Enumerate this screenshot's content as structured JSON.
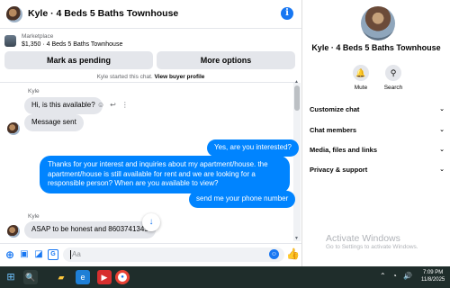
{
  "header": {
    "title": "Kyle · 4 Beds 5 Baths Townhouse"
  },
  "marketplace": {
    "label": "Marketplace",
    "item": "$1,350 · 4 Beds 5 Baths Townhouse"
  },
  "actions": {
    "mark_pending": "Mark as pending",
    "more_options": "More options"
  },
  "chat_start": {
    "prefix": "Kyle started this chat.",
    "link": "View buyer profile"
  },
  "messages": [
    {
      "sender": "Kyle",
      "text": "Hi, is this available?",
      "direction": "in"
    },
    {
      "sender": "",
      "text": "Message sent",
      "direction": "in"
    },
    {
      "sender": "",
      "text": "Yes, are you interested?",
      "direction": "out"
    },
    {
      "sender": "",
      "text": "Thanks for your interest and inquiries about my apartment/house. the apartment/house is still available for rent and we are looking for a responsible person? When are you available to view?",
      "direction": "out"
    },
    {
      "sender": "",
      "text": "send me your phone number",
      "direction": "out"
    },
    {
      "sender": "Kyle",
      "text": "ASAP to be honest and 8603741349",
      "direction": "in"
    }
  ],
  "composer": {
    "placeholder": "Aa"
  },
  "right_panel": {
    "name": "Kyle · 4 Beds 5 Baths Townhouse",
    "mute": "Mute",
    "search": "Search",
    "sections": [
      "Customize chat",
      "Chat members",
      "Media, files and links",
      "Privacy & support"
    ]
  },
  "watermark": {
    "title": "Activate Windows",
    "subtitle": "Go to Settings to activate Windows."
  },
  "taskbar": {
    "time": "7:09 PM",
    "date": "11/8/2025"
  },
  "colors": {
    "accent": "#1877f2",
    "bubble_out": "#0084ff",
    "bubble_in": "#e4e6eb",
    "taskbar": "#1f2d2b"
  }
}
